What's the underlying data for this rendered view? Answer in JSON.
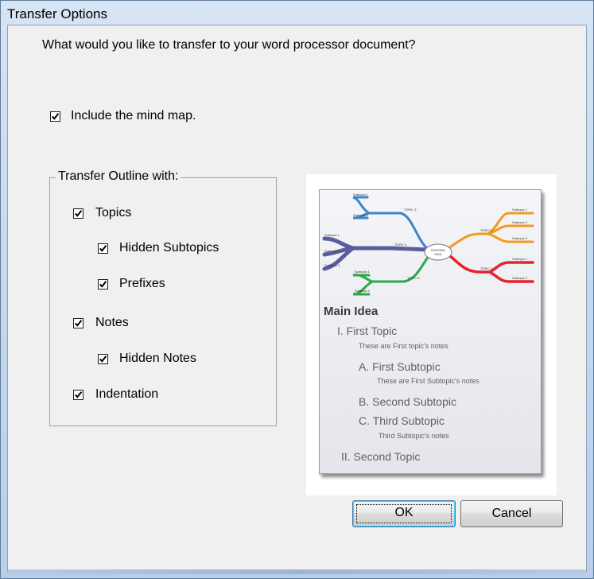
{
  "window": {
    "title": "Transfer Options"
  },
  "question": "What would you like to transfer to your word processor document?",
  "include_mind_map": {
    "label": "Include the mind map.",
    "checked": true
  },
  "outline_group": {
    "legend": "Transfer Outline with:",
    "options": [
      {
        "label": "Topics",
        "checked": true
      },
      {
        "label": "Hidden Subtopics",
        "checked": true
      },
      {
        "label": "Prefixes",
        "checked": true
      },
      {
        "label": "Notes",
        "checked": true
      },
      {
        "label": "Hidden Notes",
        "checked": true
      },
      {
        "label": "Indentation",
        "checked": true
      }
    ]
  },
  "preview": {
    "mindmap": {
      "central": [
        "CENTRAL",
        "IDEA"
      ],
      "topics": [
        "TOPIC 1",
        "TOPIC 2",
        "TOPIC 3",
        "TOPIC 4",
        "TOPIC 5"
      ],
      "subtopics": {
        "topic1": [
          "Subtopic 1",
          "Subtopic 2",
          "Subtopic 3"
        ],
        "topic2": [
          "Subtopic 1",
          "Subtopic 2"
        ],
        "topic3": [
          "Subtopic 1",
          "Subtopic 2"
        ],
        "topic4": [
          "Subtopic 1",
          "Subtopic 2",
          "Subtopic 3"
        ],
        "topic5": [
          "Subtopic 1",
          "Subtopic 2"
        ]
      },
      "colors": {
        "topic1": "#f39a1e",
        "topic2": "#e8212f",
        "topic3": "#3d86c6",
        "topic4": "#5a5d9c",
        "topic5": "#2ca84a"
      }
    },
    "outline": {
      "main": "Main Idea",
      "topic1": "I. First Topic",
      "topic1_note": "These are First topic's notes",
      "sub_a": "A. First Subtopic",
      "sub_a_note": "These are First Subtopic's notes",
      "sub_b": "B. Second Subtopic",
      "sub_c": "C. Third Subtopic",
      "sub_c_note": "Third Subtopic's notes",
      "topic2": "II. Second Topic"
    }
  },
  "buttons": {
    "ok": "OK",
    "cancel": "Cancel"
  }
}
